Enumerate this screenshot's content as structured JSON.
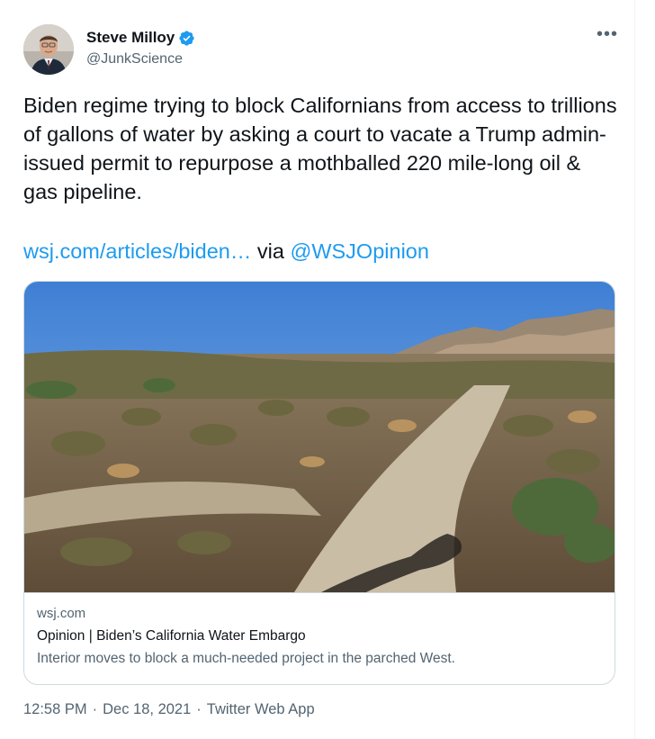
{
  "author": {
    "display_name": "Steve Milloy",
    "handle": "@JunkScience",
    "verified_icon": "verified-badge-icon",
    "avatar": "profile-photo"
  },
  "more_icon_glyph": "•••",
  "tweet": {
    "text": "Biden regime trying to block Californians from access to trillions of gallons of water by asking a court to vacate a Trump admin-issued permit to repurpose a mothballed 220 mile-long oil & gas pipeline.",
    "link_text": "wsj.com/articles/biden…",
    "via_text": "via",
    "mention": "@WSJOpinion"
  },
  "card": {
    "image": "desert-landscape-photo",
    "domain": "wsj.com",
    "title": "Opinion | Biden’s California Water Embargo",
    "description": "Interior moves to block a much-needed project in the parched West."
  },
  "meta": {
    "time": "12:58 PM",
    "separator": "·",
    "date": "Dec 18, 2021",
    "app": "Twitter Web App"
  },
  "colors": {
    "link": "#1d9bf0",
    "secondary_text": "#536471",
    "border": "#cfd9de"
  }
}
